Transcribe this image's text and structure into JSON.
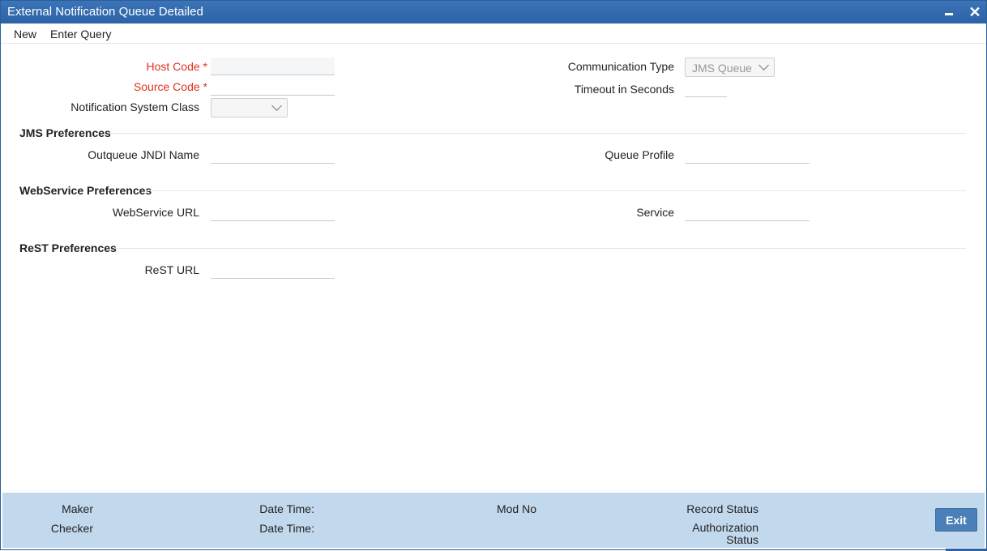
{
  "window": {
    "title": "External Notification Queue Detailed"
  },
  "menu": {
    "new": "New",
    "enter_query": "Enter Query"
  },
  "form": {
    "host_code_label": "Host Code",
    "source_code_label": "Source Code",
    "required_mark": "*",
    "notification_system_class_label": "Notification System Class",
    "communication_type_label": "Communication Type",
    "communication_type_value": "JMS Queue",
    "timeout_label": "Timeout in Seconds"
  },
  "jms": {
    "heading": "JMS Preferences",
    "outqueue_label": "Outqueue JNDI Name",
    "queue_profile_label": "Queue Profile"
  },
  "webservice": {
    "heading": "WebService Preferences",
    "url_label": "WebService URL",
    "service_label": "Service"
  },
  "rest": {
    "heading": "ReST Preferences",
    "url_label": "ReST URL"
  },
  "footer": {
    "maker": "Maker",
    "checker": "Checker",
    "date_time_1": "Date Time:",
    "date_time_2": "Date Time:",
    "mod_no": "Mod No",
    "record_status": "Record Status",
    "authorization_line1": "Authorization",
    "authorization_line2": "Status",
    "exit": "Exit"
  },
  "colors": {
    "title_bar": "#2d62a6",
    "required": "#e0301e",
    "footer": "#c2d8ec",
    "exit_button": "#4a7fb8"
  }
}
